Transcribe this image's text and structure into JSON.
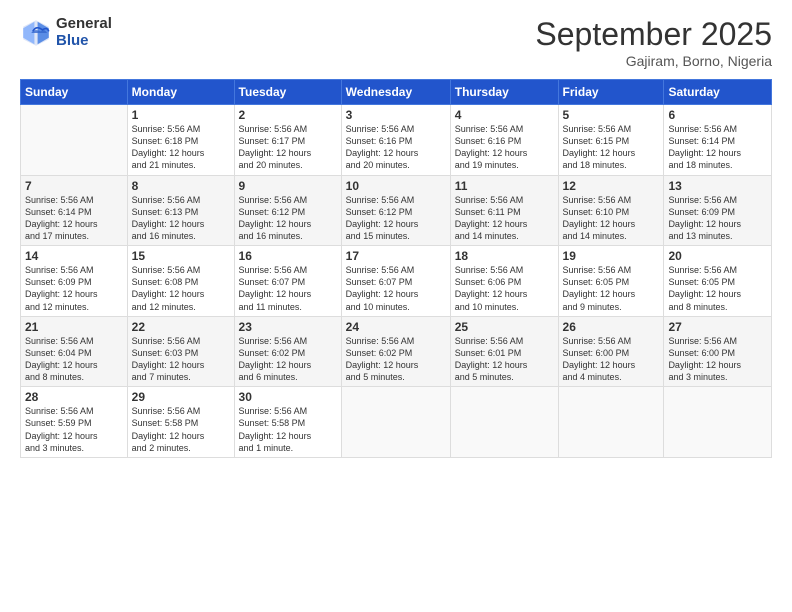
{
  "logo": {
    "general": "General",
    "blue": "Blue"
  },
  "header": {
    "month": "September 2025",
    "location": "Gajiram, Borno, Nigeria"
  },
  "weekdays": [
    "Sunday",
    "Monday",
    "Tuesday",
    "Wednesday",
    "Thursday",
    "Friday",
    "Saturday"
  ],
  "weeks": [
    [
      {
        "day": "",
        "info": ""
      },
      {
        "day": "1",
        "info": "Sunrise: 5:56 AM\nSunset: 6:18 PM\nDaylight: 12 hours\nand 21 minutes."
      },
      {
        "day": "2",
        "info": "Sunrise: 5:56 AM\nSunset: 6:17 PM\nDaylight: 12 hours\nand 20 minutes."
      },
      {
        "day": "3",
        "info": "Sunrise: 5:56 AM\nSunset: 6:16 PM\nDaylight: 12 hours\nand 20 minutes."
      },
      {
        "day": "4",
        "info": "Sunrise: 5:56 AM\nSunset: 6:16 PM\nDaylight: 12 hours\nand 19 minutes."
      },
      {
        "day": "5",
        "info": "Sunrise: 5:56 AM\nSunset: 6:15 PM\nDaylight: 12 hours\nand 18 minutes."
      },
      {
        "day": "6",
        "info": "Sunrise: 5:56 AM\nSunset: 6:14 PM\nDaylight: 12 hours\nand 18 minutes."
      }
    ],
    [
      {
        "day": "7",
        "info": "Sunrise: 5:56 AM\nSunset: 6:14 PM\nDaylight: 12 hours\nand 17 minutes."
      },
      {
        "day": "8",
        "info": "Sunrise: 5:56 AM\nSunset: 6:13 PM\nDaylight: 12 hours\nand 16 minutes."
      },
      {
        "day": "9",
        "info": "Sunrise: 5:56 AM\nSunset: 6:12 PM\nDaylight: 12 hours\nand 16 minutes."
      },
      {
        "day": "10",
        "info": "Sunrise: 5:56 AM\nSunset: 6:12 PM\nDaylight: 12 hours\nand 15 minutes."
      },
      {
        "day": "11",
        "info": "Sunrise: 5:56 AM\nSunset: 6:11 PM\nDaylight: 12 hours\nand 14 minutes."
      },
      {
        "day": "12",
        "info": "Sunrise: 5:56 AM\nSunset: 6:10 PM\nDaylight: 12 hours\nand 14 minutes."
      },
      {
        "day": "13",
        "info": "Sunrise: 5:56 AM\nSunset: 6:09 PM\nDaylight: 12 hours\nand 13 minutes."
      }
    ],
    [
      {
        "day": "14",
        "info": "Sunrise: 5:56 AM\nSunset: 6:09 PM\nDaylight: 12 hours\nand 12 minutes."
      },
      {
        "day": "15",
        "info": "Sunrise: 5:56 AM\nSunset: 6:08 PM\nDaylight: 12 hours\nand 12 minutes."
      },
      {
        "day": "16",
        "info": "Sunrise: 5:56 AM\nSunset: 6:07 PM\nDaylight: 12 hours\nand 11 minutes."
      },
      {
        "day": "17",
        "info": "Sunrise: 5:56 AM\nSunset: 6:07 PM\nDaylight: 12 hours\nand 10 minutes."
      },
      {
        "day": "18",
        "info": "Sunrise: 5:56 AM\nSunset: 6:06 PM\nDaylight: 12 hours\nand 10 minutes."
      },
      {
        "day": "19",
        "info": "Sunrise: 5:56 AM\nSunset: 6:05 PM\nDaylight: 12 hours\nand 9 minutes."
      },
      {
        "day": "20",
        "info": "Sunrise: 5:56 AM\nSunset: 6:05 PM\nDaylight: 12 hours\nand 8 minutes."
      }
    ],
    [
      {
        "day": "21",
        "info": "Sunrise: 5:56 AM\nSunset: 6:04 PM\nDaylight: 12 hours\nand 8 minutes."
      },
      {
        "day": "22",
        "info": "Sunrise: 5:56 AM\nSunset: 6:03 PM\nDaylight: 12 hours\nand 7 minutes."
      },
      {
        "day": "23",
        "info": "Sunrise: 5:56 AM\nSunset: 6:02 PM\nDaylight: 12 hours\nand 6 minutes."
      },
      {
        "day": "24",
        "info": "Sunrise: 5:56 AM\nSunset: 6:02 PM\nDaylight: 12 hours\nand 5 minutes."
      },
      {
        "day": "25",
        "info": "Sunrise: 5:56 AM\nSunset: 6:01 PM\nDaylight: 12 hours\nand 5 minutes."
      },
      {
        "day": "26",
        "info": "Sunrise: 5:56 AM\nSunset: 6:00 PM\nDaylight: 12 hours\nand 4 minutes."
      },
      {
        "day": "27",
        "info": "Sunrise: 5:56 AM\nSunset: 6:00 PM\nDaylight: 12 hours\nand 3 minutes."
      }
    ],
    [
      {
        "day": "28",
        "info": "Sunrise: 5:56 AM\nSunset: 5:59 PM\nDaylight: 12 hours\nand 3 minutes."
      },
      {
        "day": "29",
        "info": "Sunrise: 5:56 AM\nSunset: 5:58 PM\nDaylight: 12 hours\nand 2 minutes."
      },
      {
        "day": "30",
        "info": "Sunrise: 5:56 AM\nSunset: 5:58 PM\nDaylight: 12 hours\nand 1 minute."
      },
      {
        "day": "",
        "info": ""
      },
      {
        "day": "",
        "info": ""
      },
      {
        "day": "",
        "info": ""
      },
      {
        "day": "",
        "info": ""
      }
    ]
  ]
}
